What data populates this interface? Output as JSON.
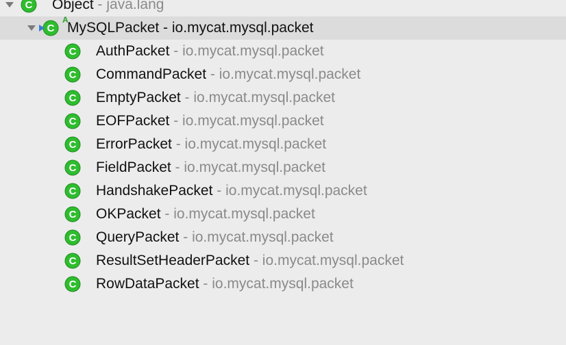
{
  "tree": {
    "root": {
      "name": "Object",
      "separator": " - ",
      "package": "java.lang",
      "expanded": true,
      "icon": "class-icon"
    },
    "selected": {
      "name": "MySQLPacket",
      "separator": " - ",
      "package": "io.mycat.mysql.packet",
      "expanded": true,
      "icon": "abstract-class-icon",
      "abstract_mark": "A"
    },
    "children": [
      {
        "name": "AuthPacket",
        "separator": " - ",
        "package": "io.mycat.mysql.packet"
      },
      {
        "name": "CommandPacket",
        "separator": " - ",
        "package": "io.mycat.mysql.packet"
      },
      {
        "name": "EmptyPacket",
        "separator": " - ",
        "package": "io.mycat.mysql.packet"
      },
      {
        "name": "EOFPacket",
        "separator": " - ",
        "package": "io.mycat.mysql.packet"
      },
      {
        "name": "ErrorPacket",
        "separator": " - ",
        "package": "io.mycat.mysql.packet"
      },
      {
        "name": "FieldPacket",
        "separator": " - ",
        "package": "io.mycat.mysql.packet"
      },
      {
        "name": "HandshakePacket",
        "separator": " - ",
        "package": "io.mycat.mysql.packet"
      },
      {
        "name": "OKPacket",
        "separator": " - ",
        "package": "io.mycat.mysql.packet"
      },
      {
        "name": "QueryPacket",
        "separator": " - ",
        "package": "io.mycat.mysql.packet"
      },
      {
        "name": "ResultSetHeaderPacket",
        "separator": " - ",
        "package": "io.mycat.mysql.packet"
      },
      {
        "name": "RowDataPacket",
        "separator": " - ",
        "package": "io.mycat.mysql.packet"
      }
    ]
  },
  "colors": {
    "background": "#ececec",
    "selected_row": "#dcdcdc",
    "class_icon_fill": "#2ebd2e",
    "class_icon_letter": "#ffffff",
    "package_text": "#8a8a8a",
    "name_text": "#111111"
  }
}
